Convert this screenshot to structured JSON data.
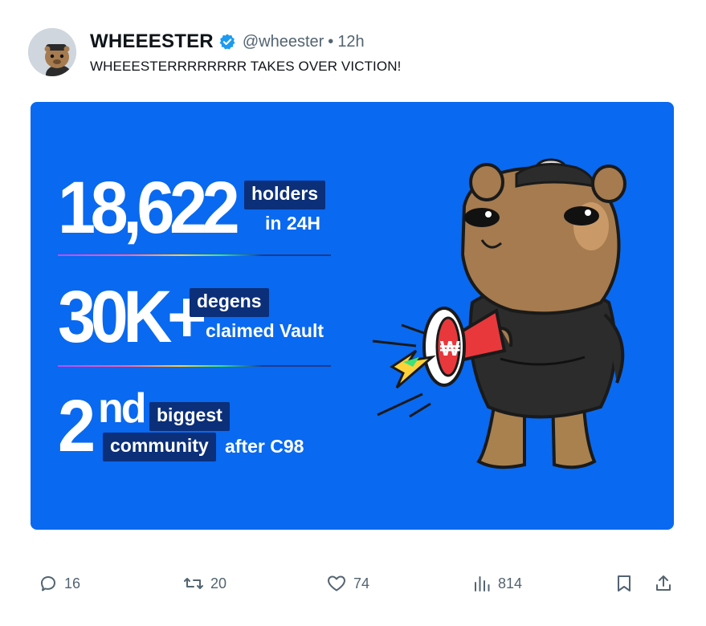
{
  "tweet": {
    "display_name": "WHEEESTER",
    "handle": "@wheester",
    "separator": "•",
    "time": "12h",
    "text": "WHEEESTERRRRRRRR TAKES OVER VICTION!",
    "verified_color": "#1d9bf0"
  },
  "media": {
    "background_color": "#0969f0",
    "stats": [
      {
        "big": "18,622",
        "tag": "holders",
        "sub": "in 24H"
      },
      {
        "big": "30K+",
        "tag": "degens",
        "sub": "claimed Vault"
      },
      {
        "big": "2",
        "sup": "nd",
        "tag": "biggest",
        "tag2": "community",
        "sub": "after C98"
      }
    ]
  },
  "actions": {
    "reply_count": "16",
    "retweet_count": "20",
    "like_count": "74",
    "view_count": "814"
  },
  "icons": [
    "reply-icon",
    "retweet-icon",
    "like-icon",
    "views-icon",
    "bookmark-icon",
    "share-icon",
    "verified-badge-icon"
  ]
}
